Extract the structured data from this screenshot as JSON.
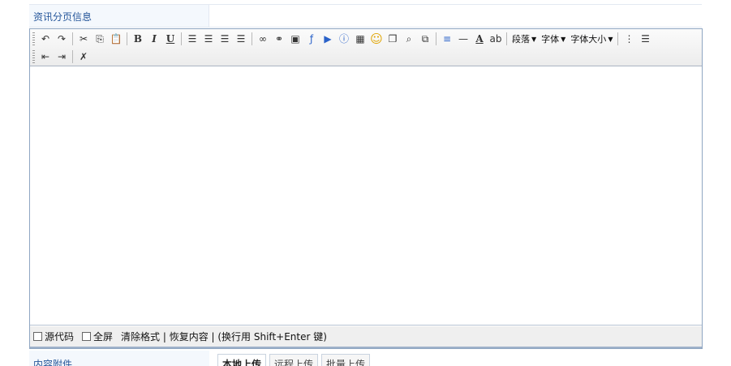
{
  "form": {
    "page_info_label": "资讯分页信息",
    "attachments_label": "内容附件"
  },
  "toolbar": {
    "row1": [
      {
        "icon": "undo-icon",
        "glyph": "↶"
      },
      {
        "icon": "redo-icon",
        "glyph": "↷"
      },
      {
        "sep": true
      },
      {
        "icon": "cut-icon",
        "glyph": "✂"
      },
      {
        "icon": "copy-icon",
        "glyph": "⎘"
      },
      {
        "icon": "paste-icon",
        "glyph": "📋"
      },
      {
        "sep": true
      },
      {
        "icon": "bold-icon",
        "glyph": "B",
        "cls": "b"
      },
      {
        "icon": "italic-icon",
        "glyph": "I",
        "cls": "i"
      },
      {
        "icon": "underline-icon",
        "glyph": "U",
        "cls": "u"
      },
      {
        "sep": true
      },
      {
        "icon": "align-left-icon",
        "glyph": "☰"
      },
      {
        "icon": "align-center-icon",
        "glyph": "☰"
      },
      {
        "icon": "align-right-icon",
        "glyph": "☰"
      },
      {
        "icon": "justify-icon",
        "glyph": "☰"
      },
      {
        "sep": true
      },
      {
        "icon": "link-icon",
        "glyph": "∞"
      },
      {
        "icon": "unlink-icon",
        "glyph": "⚭"
      },
      {
        "icon": "image-icon",
        "glyph": "▣"
      },
      {
        "icon": "flash-icon",
        "glyph": "ƒ",
        "cls": "blue"
      },
      {
        "icon": "media-icon",
        "glyph": "▶",
        "cls": "blue"
      },
      {
        "icon": "info-icon",
        "glyph": "ⓘ",
        "cls": "blue"
      },
      {
        "icon": "table-icon",
        "glyph": "▦"
      },
      {
        "icon": "emoticon-icon",
        "glyph": "☺",
        "cls": "smile"
      },
      {
        "icon": "quote-icon",
        "glyph": "❐"
      },
      {
        "icon": "find-icon",
        "glyph": "⌕"
      },
      {
        "icon": "template-icon",
        "glyph": "⧉"
      },
      {
        "sep": true
      },
      {
        "icon": "page-break-icon",
        "glyph": "≡",
        "cls": "blue"
      },
      {
        "icon": "horizontal-rule-icon",
        "glyph": "—"
      },
      {
        "icon": "font-color-icon",
        "glyph": "A",
        "cls": "u"
      },
      {
        "icon": "highlight-icon",
        "glyph": "ab"
      },
      {
        "sep": true
      },
      {
        "drop": "paragraph",
        "label": "段落"
      },
      {
        "drop": "font",
        "label": "字体"
      },
      {
        "drop": "font-size",
        "label": "字体大小"
      },
      {
        "sep": true
      },
      {
        "icon": "ordered-list-icon",
        "glyph": "⋮"
      },
      {
        "icon": "unordered-list-icon",
        "glyph": "☰"
      }
    ],
    "row2": [
      {
        "icon": "outdent-icon",
        "glyph": "⇤"
      },
      {
        "icon": "indent-icon",
        "glyph": "⇥"
      },
      {
        "sep": true
      },
      {
        "icon": "remove-format-icon",
        "glyph": "✗"
      }
    ]
  },
  "statusbar": {
    "source_label": "源代码",
    "fullscreen_label": "全屏",
    "info": "清除格式 | 恢复内容 | (换行用 Shift+Enter 键)"
  },
  "upload_tabs": [
    "本地上传",
    "远程上传",
    "批量上传"
  ]
}
